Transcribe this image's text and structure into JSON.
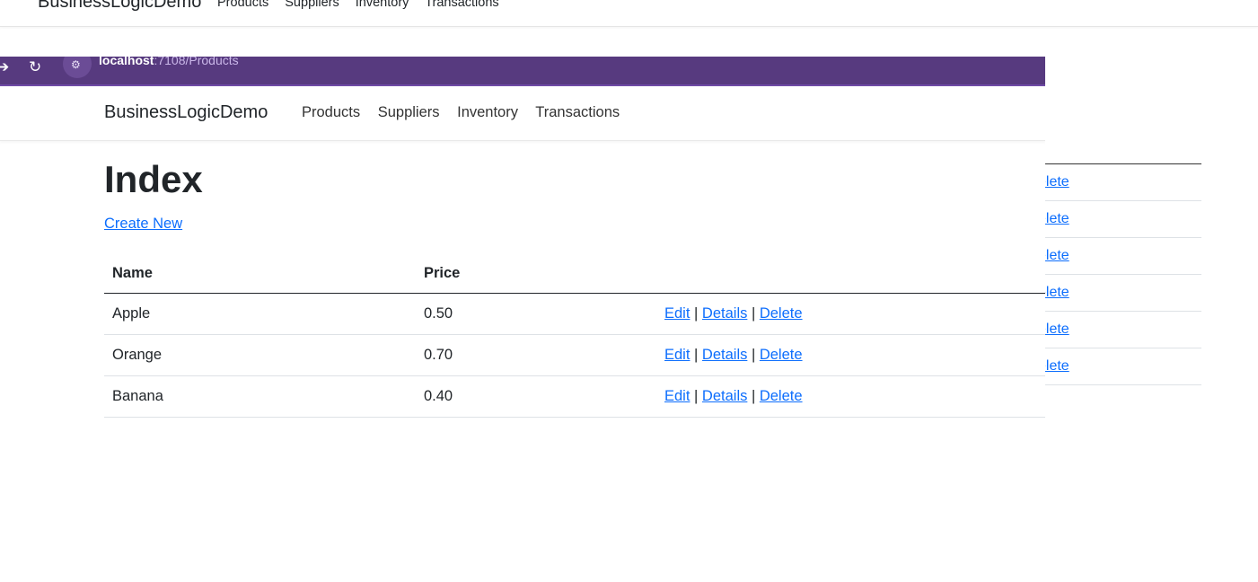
{
  "background_window": {
    "brand": "BusinessLogicDemo",
    "nav_links": [
      "Products",
      "Suppliers",
      "Inventory",
      "Transactions"
    ],
    "delete_links": [
      "elete",
      "elete",
      "elete",
      "elete",
      "elete",
      "elete"
    ]
  },
  "browser": {
    "url_host": "localhost",
    "url_path": ":7108/Products"
  },
  "navbar": {
    "brand": "BusinessLogicDemo",
    "links": [
      "Products",
      "Suppliers",
      "Inventory",
      "Transactions"
    ]
  },
  "page": {
    "title": "Index",
    "create_link": "Create New"
  },
  "table": {
    "headers": {
      "name": "Name",
      "price": "Price"
    },
    "rows": [
      {
        "name": "Apple",
        "price": "0.50"
      },
      {
        "name": "Orange",
        "price": "0.70"
      },
      {
        "name": "Banana",
        "price": "0.40"
      }
    ],
    "actions": {
      "edit": "Edit",
      "details": "Details",
      "delete": "Delete",
      "separator": "|"
    }
  }
}
